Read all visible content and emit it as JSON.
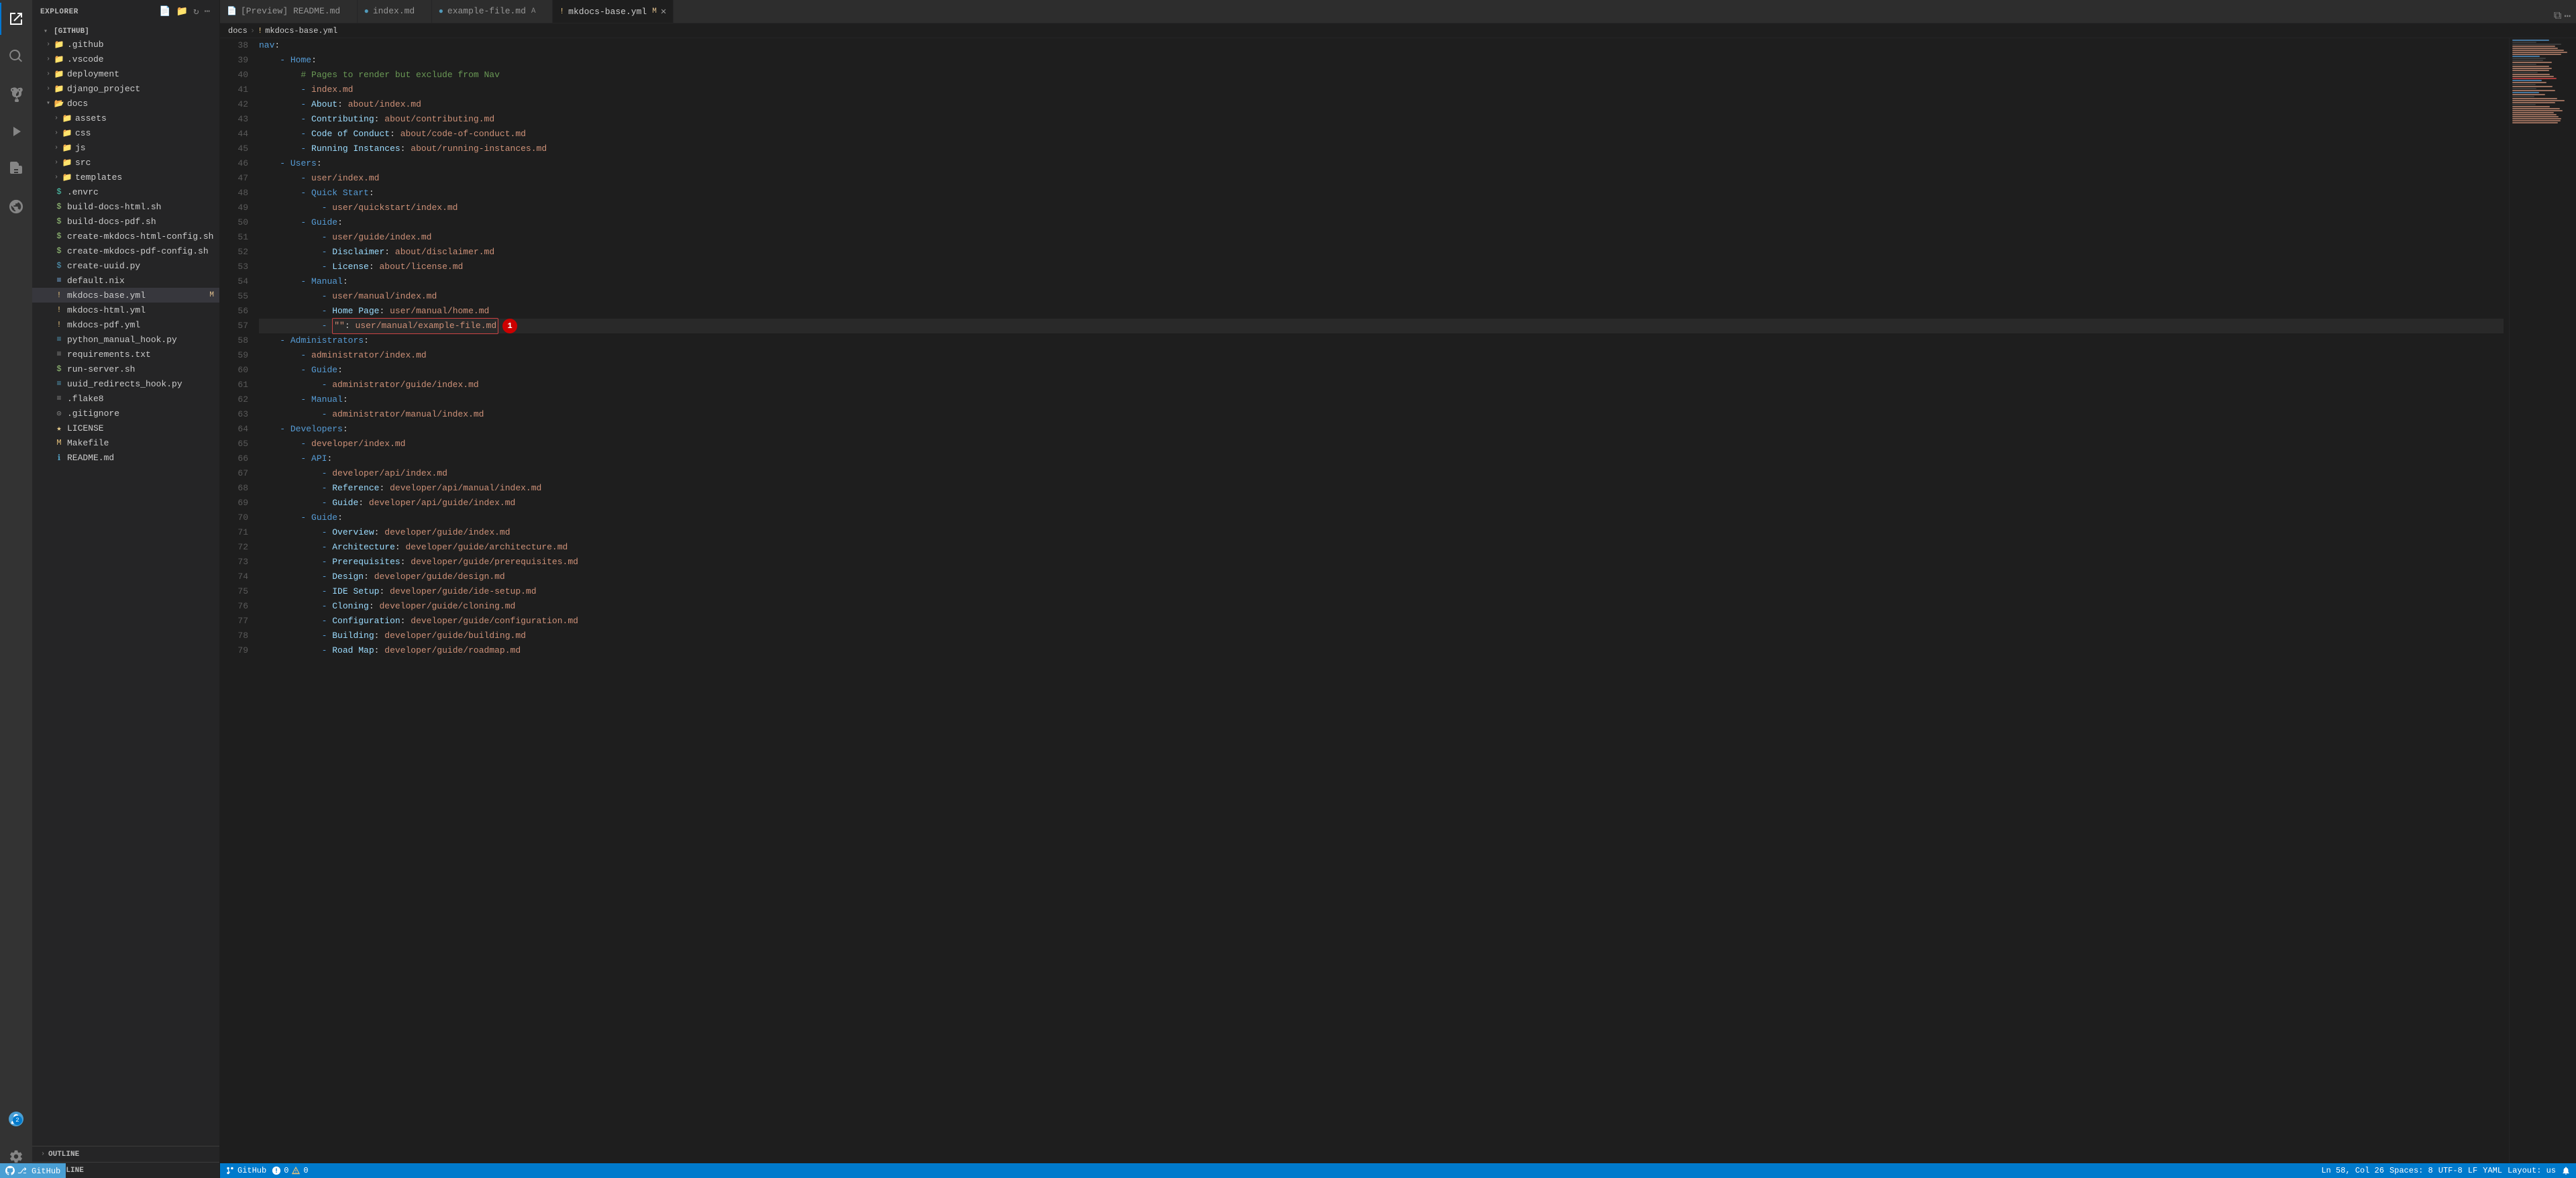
{
  "titleBar": {
    "hamburger": "≡"
  },
  "activityBar": {
    "items": [
      {
        "name": "explorer",
        "icon": "⎘",
        "tooltip": "Explorer",
        "active": true
      },
      {
        "name": "search",
        "icon": "🔍",
        "tooltip": "Search"
      },
      {
        "name": "source-control",
        "icon": "⑂",
        "tooltip": "Source Control"
      },
      {
        "name": "run",
        "icon": "▷",
        "tooltip": "Run and Debug"
      },
      {
        "name": "extensions",
        "icon": "⧉",
        "tooltip": "Extensions"
      },
      {
        "name": "remote",
        "icon": "◎",
        "tooltip": "Remote Explorer"
      }
    ],
    "bottomItems": [
      {
        "name": "accounts",
        "icon": "👤",
        "tooltip": "Accounts"
      },
      {
        "name": "settings",
        "icon": "⚙",
        "tooltip": "Settings"
      }
    ]
  },
  "sidebar": {
    "title": "EXPLORER",
    "root": "[GITHUB]",
    "tree": [
      {
        "id": "github",
        "label": ".github",
        "type": "folder",
        "indent": 1,
        "collapsed": true
      },
      {
        "id": "vscode",
        "label": ".vscode",
        "type": "folder",
        "indent": 1,
        "collapsed": true
      },
      {
        "id": "deployment",
        "label": "deployment",
        "type": "folder",
        "indent": 1,
        "collapsed": true
      },
      {
        "id": "django_project",
        "label": "django_project",
        "type": "folder",
        "indent": 1,
        "collapsed": true
      },
      {
        "id": "docs",
        "label": "docs",
        "type": "folder",
        "indent": 1,
        "expanded": true
      },
      {
        "id": "assets",
        "label": "assets",
        "type": "folder",
        "indent": 2,
        "collapsed": true
      },
      {
        "id": "css",
        "label": "css",
        "type": "folder",
        "indent": 2,
        "collapsed": true
      },
      {
        "id": "js",
        "label": "js",
        "type": "folder",
        "indent": 2,
        "collapsed": true
      },
      {
        "id": "src",
        "label": "src",
        "type": "folder",
        "indent": 2,
        "collapsed": true
      },
      {
        "id": "templates",
        "label": "templates",
        "type": "folder",
        "indent": 2,
        "collapsed": true
      },
      {
        "id": "envrc",
        "label": ".envrc",
        "type": "file",
        "indent": 1,
        "fileType": "env"
      },
      {
        "id": "build-docs-html",
        "label": "build-docs-html.sh",
        "type": "file",
        "indent": 1,
        "fileType": "sh"
      },
      {
        "id": "build-docs-pdf",
        "label": "build-docs-pdf.sh",
        "type": "file",
        "indent": 1,
        "fileType": "sh"
      },
      {
        "id": "create-mkdocs-html",
        "label": "create-mkdocs-html-config.sh",
        "type": "file",
        "indent": 1,
        "fileType": "sh"
      },
      {
        "id": "create-mkdocs-pdf",
        "label": "create-mkdocs-pdf-config.sh",
        "type": "file",
        "indent": 1,
        "fileType": "sh"
      },
      {
        "id": "create-uuid",
        "label": "create-uuid.py",
        "type": "file",
        "indent": 1,
        "fileType": "py"
      },
      {
        "id": "default-nix",
        "label": "default.nix",
        "type": "file",
        "indent": 1,
        "fileType": "nix"
      },
      {
        "id": "mkdocs-base",
        "label": "mkdocs-base.yml",
        "type": "file",
        "indent": 1,
        "fileType": "yml",
        "active": true,
        "badge": "M"
      },
      {
        "id": "mkdocs-html",
        "label": "mkdocs-html.yml",
        "type": "file",
        "indent": 1,
        "fileType": "yml"
      },
      {
        "id": "mkdocs-pdf",
        "label": "mkdocs-pdf.yml",
        "type": "file",
        "indent": 1,
        "fileType": "yml"
      },
      {
        "id": "python-hook",
        "label": "python_manual_hook.py",
        "type": "file",
        "indent": 1,
        "fileType": "py"
      },
      {
        "id": "requirements",
        "label": "requirements.txt",
        "type": "file",
        "indent": 1,
        "fileType": "txt"
      },
      {
        "id": "run-server",
        "label": "run-server.sh",
        "type": "file",
        "indent": 1,
        "fileType": "sh"
      },
      {
        "id": "uuid-hook",
        "label": "uuid_redirects_hook.py",
        "type": "file",
        "indent": 1,
        "fileType": "py"
      },
      {
        "id": "flake8",
        "label": ".flake8",
        "type": "file",
        "indent": 1,
        "fileType": "config"
      },
      {
        "id": "gitignore",
        "label": ".gitignore",
        "type": "file",
        "indent": 1,
        "fileType": "git"
      },
      {
        "id": "license",
        "label": "LICENSE",
        "type": "file",
        "indent": 1,
        "fileType": "license"
      },
      {
        "id": "makefile",
        "label": "Makefile",
        "type": "file",
        "indent": 1,
        "fileType": "make"
      },
      {
        "id": "readme",
        "label": "README.md",
        "type": "file",
        "indent": 1,
        "fileType": "md"
      }
    ],
    "outline": "OUTLINE",
    "timeline": "TIMELINE"
  },
  "tabs": [
    {
      "id": "preview-readme",
      "label": "[Preview] README.md",
      "icon": "📄",
      "active": false,
      "modified": false
    },
    {
      "id": "index-md",
      "label": "index.md",
      "icon": "📄",
      "active": false,
      "modified": false
    },
    {
      "id": "example-file",
      "label": "example-file.md",
      "icon": "📄",
      "active": false,
      "modified": false,
      "badge": "A"
    },
    {
      "id": "mkdocs-base",
      "label": "mkdocs-base.yml",
      "icon": "!",
      "active": true,
      "modified": true,
      "badge": "M"
    }
  ],
  "breadcrumb": {
    "parts": [
      "docs",
      "!",
      "mkdocs-base.yml"
    ]
  },
  "editor": {
    "lines": [
      {
        "n": 38,
        "content": "nav:"
      },
      {
        "n": 39,
        "content": "    - Home:"
      },
      {
        "n": 40,
        "content": "        # Pages to render but exclude from Nav"
      },
      {
        "n": 41,
        "content": "        - index.md"
      },
      {
        "n": 42,
        "content": "        - About: about/index.md"
      },
      {
        "n": 43,
        "content": "        - Contributing: about/contributing.md"
      },
      {
        "n": 44,
        "content": "        - Code of Conduct: about/code-of-conduct.md"
      },
      {
        "n": 45,
        "content": "        - Running Instances: about/running-instances.md"
      },
      {
        "n": 46,
        "content": "    - Users:"
      },
      {
        "n": 47,
        "content": "        - user/index.md"
      },
      {
        "n": 48,
        "content": "        - Quick Start:"
      },
      {
        "n": 49,
        "content": "            - user/quickstart/index.md"
      },
      {
        "n": 50,
        "content": "        - Guide:"
      },
      {
        "n": 51,
        "content": "            - user/guide/index.md"
      },
      {
        "n": 52,
        "content": "            - Disclaimer: about/disclaimer.md"
      },
      {
        "n": 53,
        "content": "            - License: about/license.md"
      },
      {
        "n": 54,
        "content": "        - Manual:"
      },
      {
        "n": 55,
        "content": "            - user/manual/index.md"
      },
      {
        "n": 56,
        "content": "            - Home Page: user/manual/home.md"
      },
      {
        "n": 57,
        "content": "            - \"\": user/manual/example-file.md",
        "highlighted": true
      },
      {
        "n": 58,
        "content": "    - Administrators:"
      },
      {
        "n": 59,
        "content": "        - administrator/index.md"
      },
      {
        "n": 60,
        "content": "        - Guide:"
      },
      {
        "n": 61,
        "content": "            - administrator/guide/index.md"
      },
      {
        "n": 62,
        "content": "        - Manual:"
      },
      {
        "n": 63,
        "content": "            - administrator/manual/index.md"
      },
      {
        "n": 64,
        "content": "    - Developers:"
      },
      {
        "n": 65,
        "content": "        - developer/index.md"
      },
      {
        "n": 66,
        "content": "        - API:"
      },
      {
        "n": 67,
        "content": "            - developer/api/index.md"
      },
      {
        "n": 68,
        "content": "            - Reference: developer/api/manual/index.md"
      },
      {
        "n": 69,
        "content": "            - Guide: developer/api/guide/index.md"
      },
      {
        "n": 70,
        "content": "        - Guide:"
      },
      {
        "n": 71,
        "content": "            - Overview: developer/guide/index.md"
      },
      {
        "n": 72,
        "content": "            - Architecture: developer/guide/architecture.md"
      },
      {
        "n": 73,
        "content": "            - Prerequisites: developer/guide/prerequisites.md"
      },
      {
        "n": 74,
        "content": "            - Design: developer/guide/design.md"
      },
      {
        "n": 75,
        "content": "            - IDE Setup: developer/guide/ide-setup.md"
      },
      {
        "n": 76,
        "content": "            - Cloning: developer/guide/cloning.md"
      },
      {
        "n": 77,
        "content": "            - Configuration: developer/guide/configuration.md"
      },
      {
        "n": 78,
        "content": "            - Building: developer/guide/building.md"
      },
      {
        "n": 79,
        "content": "            - Road Map: developer/guide/roadmap.md"
      }
    ]
  },
  "statusBar": {
    "gitBranch": "GitHub",
    "errors": "0",
    "warnings": "0",
    "position": "Ln 58, Col 26",
    "spaces": "Spaces: 8",
    "encoding": "UTF-8",
    "lineEnding": "LF",
    "language": "YAML",
    "layout": "Layout: us"
  }
}
